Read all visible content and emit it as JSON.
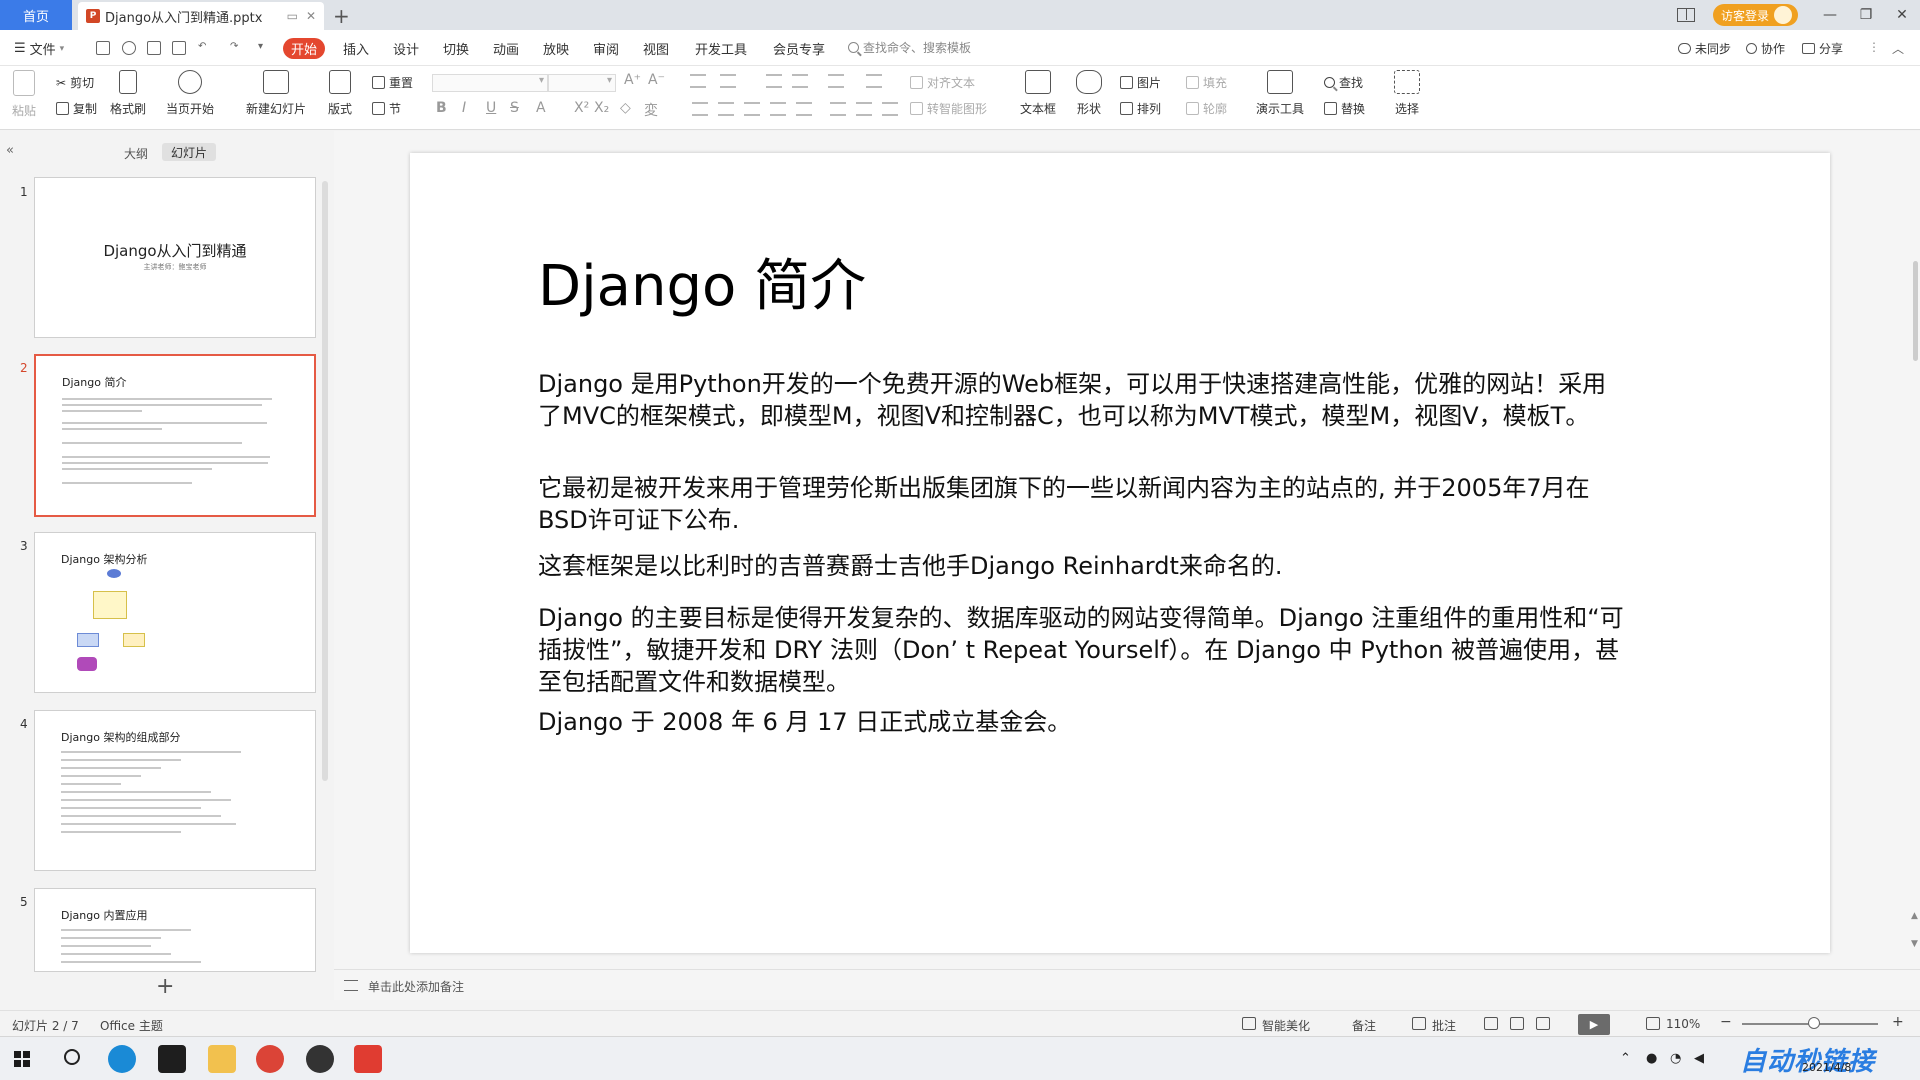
{
  "window": {
    "home_tab": "首页",
    "doc_tab": "Django从入门到精通.pptx",
    "guest_login": "访客登录"
  },
  "menu": {
    "file": "文件",
    "tabs": [
      "开始",
      "插入",
      "设计",
      "切换",
      "动画",
      "放映",
      "审阅",
      "视图",
      "开发工具",
      "会员专享"
    ],
    "search_placeholder": "查找命令、搜索模板",
    "right": [
      "未同步",
      "协作",
      "分享"
    ]
  },
  "ribbon": {
    "paste": "粘贴",
    "cut": "剪切",
    "copy": "复制",
    "format_painter": "格式刷",
    "play_current": "当页开始",
    "new_slide": "新建幻灯片",
    "layout": "版式",
    "reset": "重置",
    "section": "节",
    "align_text": "对齐文本",
    "smartart": "转智能图形",
    "textbox": "文本框",
    "shape": "形状",
    "picture": "图片",
    "fill": "填充",
    "arrange": "排列",
    "outline": "轮廓",
    "presenter_tools": "演示工具",
    "find": "查找",
    "replace": "替换",
    "select": "选择"
  },
  "left_panel": {
    "outline_tab": "大纲",
    "slides_tab": "幻灯片",
    "thumbnails": [
      {
        "num": "1",
        "title": "Django从入门到精通",
        "subtitle": "主讲老师：鲍宝老师"
      },
      {
        "num": "2",
        "title": "Django 简介"
      },
      {
        "num": "3",
        "title": "Django 架构分析"
      },
      {
        "num": "4",
        "title": "Django 架构的组成部分"
      },
      {
        "num": "5",
        "title": "Django 内置应用"
      }
    ]
  },
  "slide": {
    "title": "Django 简介",
    "paragraphs": [
      "Django 是用Python开发的一个免费开源的Web框架，可以用于快速搭建高性能，优雅的网站！采用了MVC的框架模式，即模型M，视图V和控制器C，也可以称为MVT模式，模型M，视图V，模板T。",
      "它最初是被开发来用于管理劳伦斯出版集团旗下的一些以新闻内容为主的站点的, 并于2005年7月在BSD许可证下公布.",
      "这套框架是以比利时的吉普赛爵士吉他手Django Reinhardt来命名的.",
      "Django 的主要目标是使得开发复杂的、数据库驱动的网站变得简单。Django 注重组件的重用性和“可插拔性”，敏捷开发和 DRY 法则（Don’ t Repeat Yourself）。在 Django 中 Python 被普遍使用，甚至包括配置文件和数据模型。",
      "Django 于 2008 年 6 月 17 日正式成立基金会。"
    ]
  },
  "notes": {
    "placeholder": "单击此处添加备注"
  },
  "status": {
    "slide_counter": "幻灯片 2 / 7",
    "theme": "Office 主题",
    "smart_beautify": "智能美化",
    "notes": "备注",
    "comments": "批注",
    "zoom": "110%"
  },
  "taskbar": {
    "watermark": "自动秒链接",
    "date": "2021/4/8"
  },
  "colors": {
    "accent": "#e4472f",
    "home_tab": "#3b7be8",
    "guest": "#f0a020"
  }
}
